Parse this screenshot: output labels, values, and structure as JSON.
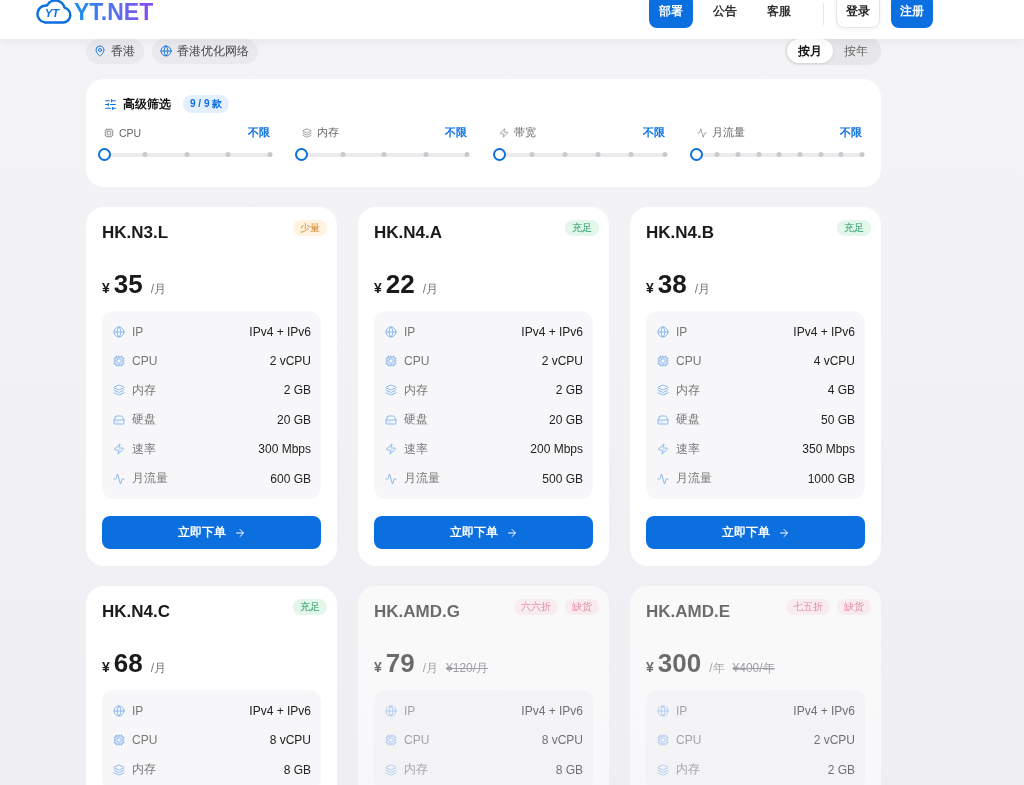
{
  "header": {
    "logo": {
      "mark": "YT",
      "text": "YT.NET"
    },
    "nav": [
      {
        "label": "部署",
        "selected": true
      },
      {
        "label": "公告",
        "selected": false
      },
      {
        "label": "客服",
        "selected": false
      }
    ],
    "login": "登录",
    "register": "注册"
  },
  "location": {
    "tags": [
      {
        "kind": "region",
        "label": "香港"
      },
      {
        "kind": "network",
        "label": "香港优化网络"
      }
    ],
    "billing": [
      {
        "label": "按月",
        "selected": true
      },
      {
        "label": "按年",
        "selected": false
      }
    ]
  },
  "filters": {
    "title": "高级筛选",
    "count": "9 / 9 款",
    "items": [
      {
        "kind": "cpu",
        "label": "CPU",
        "value": "不限",
        "level": 0
      },
      {
        "kind": "memory",
        "label": "内存",
        "value": "不限",
        "level": 0
      },
      {
        "kind": "bandwidth",
        "label": "带宽",
        "value": "不限",
        "level": 0
      },
      {
        "kind": "traffic",
        "label": "月流量",
        "value": "不限",
        "level": 0
      }
    ]
  },
  "plans": [
    {
      "name": "HK.N3.L",
      "disabled": false,
      "badges": [
        {
          "kind": "stock-low",
          "label": "少量"
        }
      ],
      "currency": "¥",
      "price": "35",
      "period": "/月",
      "specs": [
        {
          "kind": "ip",
          "label": "IP",
          "value": "IPv4 + IPv6"
        },
        {
          "kind": "cpu",
          "label": "CPU",
          "value": "2 vCPU"
        },
        {
          "kind": "memory",
          "label": "内存",
          "value": "2 GB"
        },
        {
          "kind": "disk",
          "label": "硬盘",
          "value": "20 GB"
        },
        {
          "kind": "speed",
          "label": "速率",
          "value": "300 Mbps"
        },
        {
          "kind": "traffic",
          "label": "月流量",
          "value": "600 GB"
        }
      ],
      "button": "立即下单"
    },
    {
      "name": "HK.N4.A",
      "disabled": false,
      "badges": [
        {
          "kind": "stock-ok",
          "label": "充足"
        }
      ],
      "currency": "¥",
      "price": "22",
      "period": "/月",
      "specs": [
        {
          "kind": "ip",
          "label": "IP",
          "value": "IPv4 + IPv6"
        },
        {
          "kind": "cpu",
          "label": "CPU",
          "value": "2 vCPU"
        },
        {
          "kind": "memory",
          "label": "内存",
          "value": "2 GB"
        },
        {
          "kind": "disk",
          "label": "硬盘",
          "value": "20 GB"
        },
        {
          "kind": "speed",
          "label": "速率",
          "value": "200 Mbps"
        },
        {
          "kind": "traffic",
          "label": "月流量",
          "value": "500 GB"
        }
      ],
      "button": "立即下单"
    },
    {
      "name": "HK.N4.B",
      "disabled": false,
      "badges": [
        {
          "kind": "stock-ok",
          "label": "充足"
        }
      ],
      "currency": "¥",
      "price": "38",
      "period": "/月",
      "specs": [
        {
          "kind": "ip",
          "label": "IP",
          "value": "IPv4 + IPv6"
        },
        {
          "kind": "cpu",
          "label": "CPU",
          "value": "4 vCPU"
        },
        {
          "kind": "memory",
          "label": "内存",
          "value": "4 GB"
        },
        {
          "kind": "disk",
          "label": "硬盘",
          "value": "50 GB"
        },
        {
          "kind": "speed",
          "label": "速率",
          "value": "350 Mbps"
        },
        {
          "kind": "traffic",
          "label": "月流量",
          "value": "1000 GB"
        }
      ],
      "button": "立即下单"
    },
    {
      "name": "HK.N4.C",
      "disabled": false,
      "badges": [
        {
          "kind": "stock-ok",
          "label": "充足"
        }
      ],
      "currency": "¥",
      "price": "68",
      "period": "/月",
      "specs": [
        {
          "kind": "ip",
          "label": "IP",
          "value": "IPv4 + IPv6"
        },
        {
          "kind": "cpu",
          "label": "CPU",
          "value": "8 vCPU"
        },
        {
          "kind": "memory",
          "label": "内存",
          "value": "8 GB"
        }
      ]
    },
    {
      "name": "HK.AMD.G",
      "disabled": true,
      "badges": [
        {
          "kind": "discount",
          "label": "六六折"
        },
        {
          "kind": "stock-out",
          "label": "缺货"
        }
      ],
      "currency": "¥",
      "price": "79",
      "period": "/月",
      "original_price": "¥120/月",
      "specs": [
        {
          "kind": "ip",
          "label": "IP",
          "value": "IPv4 + IPv6"
        },
        {
          "kind": "cpu",
          "label": "CPU",
          "value": "8 vCPU"
        },
        {
          "kind": "memory",
          "label": "内存",
          "value": "8 GB"
        }
      ]
    },
    {
      "name": "HK.AMD.E",
      "disabled": true,
      "badges": [
        {
          "kind": "discount",
          "label": "七五折"
        },
        {
          "kind": "stock-out",
          "label": "缺货"
        }
      ],
      "currency": "¥",
      "price": "300",
      "period": "/年",
      "original_price": "¥400/年",
      "specs": [
        {
          "kind": "ip",
          "label": "IP",
          "value": "IPv4 + IPv6"
        },
        {
          "kind": "cpu",
          "label": "CPU",
          "value": "2 vCPU"
        },
        {
          "kind": "memory",
          "label": "内存",
          "value": "2 GB"
        }
      ]
    }
  ]
}
